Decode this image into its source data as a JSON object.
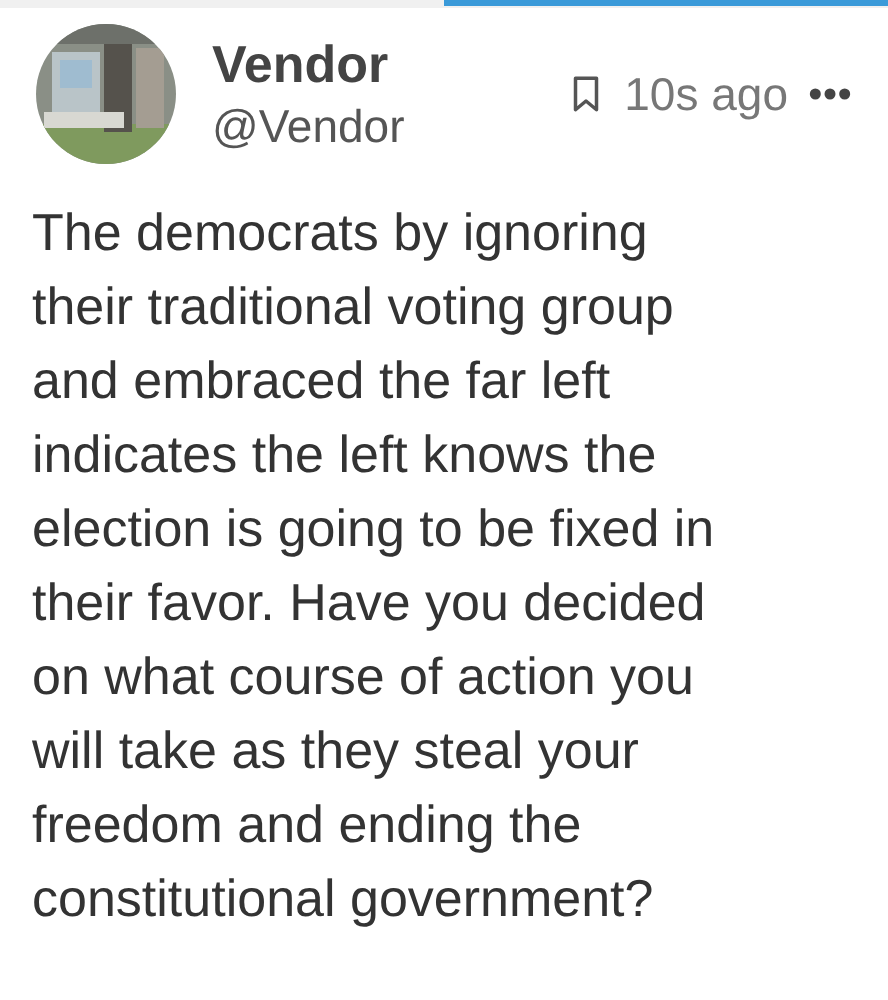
{
  "post": {
    "author": {
      "name": "Vendor",
      "handle": "@Vendor"
    },
    "bookmarked": false,
    "time": "10s ago",
    "body": "The democrats by ignoring\ntheir traditional voting group\nand embraced the far left\nindicates the left knows the\nelection is going to be fixed in\ntheir favor. Have you decided\non what course of action you\nwill take as they steal your\nfreedom and ending the\nconstitutional government?"
  }
}
